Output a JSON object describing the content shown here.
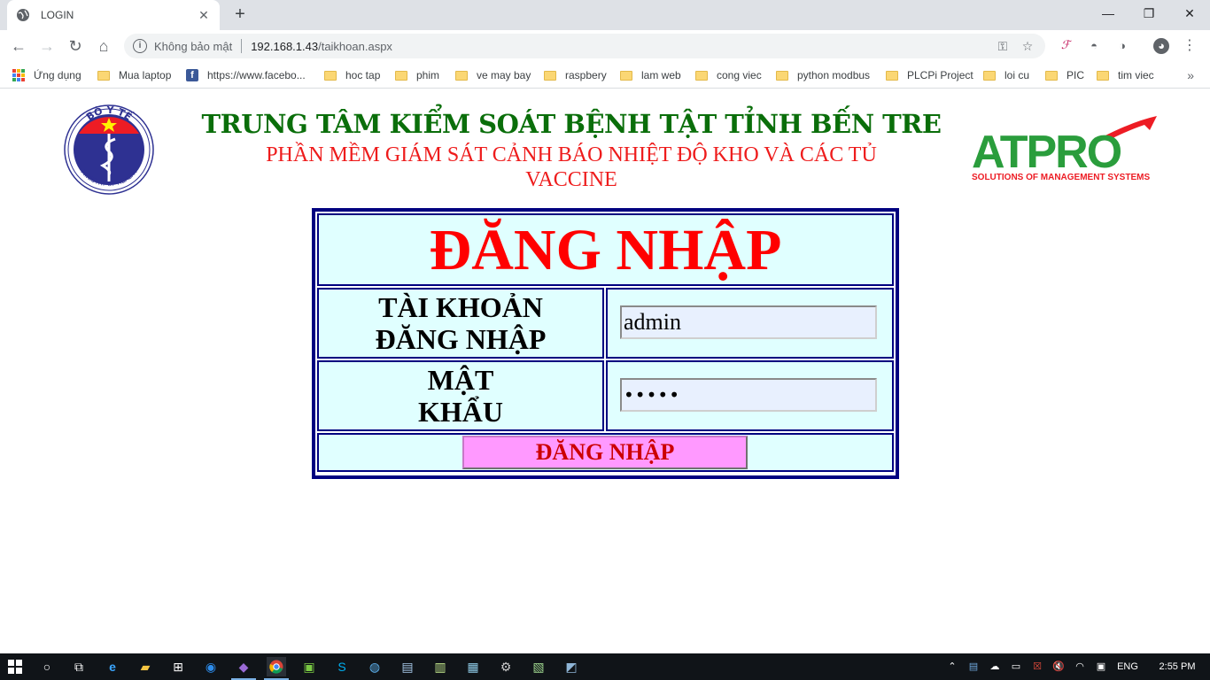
{
  "browser": {
    "tab_title": "LOGIN",
    "tab_close": "✕",
    "new_tab": "+",
    "window_controls": {
      "minimize": "—",
      "restore": "❐",
      "close": "✕"
    },
    "security_label": "Không bảo mật",
    "url_host": "192.168.1.43",
    "url_path": "/taikhoan.aspx",
    "bookmarks": [
      {
        "label": "Ứng dụng",
        "icon": "apps-icon"
      },
      {
        "label": "Mua laptop",
        "icon": "folder-icon"
      },
      {
        "label": "https://www.facebo...",
        "icon": "facebook-icon"
      },
      {
        "label": "hoc tap",
        "icon": "folder-icon"
      },
      {
        "label": "phim",
        "icon": "folder-icon"
      },
      {
        "label": "ve may bay",
        "icon": "folder-icon"
      },
      {
        "label": "raspbery",
        "icon": "folder-icon"
      },
      {
        "label": "lam web",
        "icon": "folder-icon"
      },
      {
        "label": "cong viec",
        "icon": "folder-icon"
      },
      {
        "label": "python modbus",
        "icon": "folder-icon"
      },
      {
        "label": "PLCPi Project",
        "icon": "folder-icon"
      },
      {
        "label": "loi cu",
        "icon": "folder-icon"
      },
      {
        "label": "PIC",
        "icon": "folder-icon"
      },
      {
        "label": "tim viec",
        "icon": "folder-icon"
      }
    ],
    "bookmarks_more": "»"
  },
  "header": {
    "title": "TRUNG TÂM KIỂM SOÁT BỆNH TẬT TỈNH BẾN TRE",
    "subtitle": "PHẦN MỀM GIÁM SÁT CẢNH BÁO NHIỆT ĐỘ KHO VÀ CÁC TỦ VACCINE",
    "logo_left_top": "BỘ Y TẾ",
    "logo_left_bottom": "MINISTRY OF HEALTH",
    "logo_right_brand": "ATPRO",
    "logo_right_tagline": "SOLUTIONS OF MANAGEMENT SYSTEMS"
  },
  "login": {
    "heading": "ĐĂNG NHẬP",
    "username_label_line1": "TÀI KHOẢN",
    "username_label_line2": "ĐĂNG NHẬP",
    "username_value": "admin",
    "password_label_line1": "MẬT",
    "password_label_line2": "KHẨU",
    "password_masked": "•••••",
    "submit_label": "ĐĂNG NHẬP"
  },
  "taskbar": {
    "language": "ENG",
    "time": "2:55 PM"
  },
  "colors": {
    "title_green": "#0a6e0a",
    "subtitle_red": "#ee1c1c",
    "box_border": "#000080",
    "cell_bg": "#e0ffff",
    "button_bg": "#ff99ff"
  }
}
